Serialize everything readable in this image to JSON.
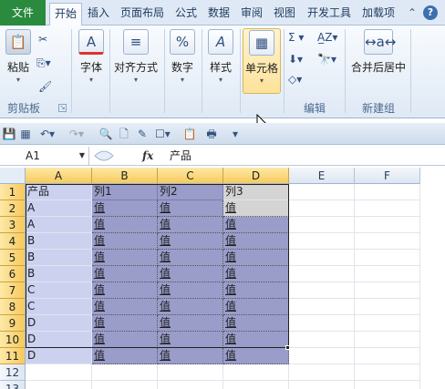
{
  "tabs": [
    {
      "label": "文件"
    },
    {
      "label": "开始"
    },
    {
      "label": "插入"
    },
    {
      "label": "页面布局"
    },
    {
      "label": "公式"
    },
    {
      "label": "数据"
    },
    {
      "label": "审阅"
    },
    {
      "label": "视图"
    },
    {
      "label": "开发工具"
    },
    {
      "label": "加载项"
    }
  ],
  "window_controls": {
    "help": "?"
  },
  "ribbon": {
    "clipboard": {
      "paste": "粘贴",
      "group": "剪贴板"
    },
    "font": {
      "label": "字体"
    },
    "alignment": {
      "label": "对齐方式"
    },
    "number": {
      "label": "数字"
    },
    "styles": {
      "label": "样式"
    },
    "cells": {
      "label": "单元格"
    },
    "editing": {
      "group": "编辑"
    },
    "new_group": {
      "merge_center": "合并后居中",
      "group": "新建组"
    }
  },
  "name_box": {
    "value": "A1"
  },
  "formula_bar": {
    "fx": "fx",
    "content": "产品"
  },
  "columns": [
    "A",
    "B",
    "C",
    "D",
    "E",
    "F"
  ],
  "rows": [
    {
      "num": "1",
      "cells": [
        "产品",
        "列1",
        "列2",
        "列3"
      ]
    },
    {
      "num": "2",
      "cells": [
        "A",
        "值",
        "值",
        "值"
      ]
    },
    {
      "num": "3",
      "cells": [
        "A",
        "值",
        "值",
        "值"
      ]
    },
    {
      "num": "4",
      "cells": [
        "B",
        "值",
        "值",
        "值"
      ]
    },
    {
      "num": "5",
      "cells": [
        "B",
        "值",
        "值",
        "值"
      ]
    },
    {
      "num": "6",
      "cells": [
        "B",
        "值",
        "值",
        "值"
      ]
    },
    {
      "num": "7",
      "cells": [
        "C",
        "值",
        "值",
        "值"
      ]
    },
    {
      "num": "8",
      "cells": [
        "C",
        "值",
        "值",
        "值"
      ]
    },
    {
      "num": "9",
      "cells": [
        "D",
        "值",
        "值",
        "值"
      ]
    },
    {
      "num": "10",
      "cells": [
        "D",
        "值",
        "值",
        "值"
      ]
    },
    {
      "num": "11",
      "cells": [
        "D",
        "值",
        "值",
        "值"
      ]
    },
    {
      "num": "12",
      "cells": [
        "",
        "",
        "",
        ""
      ]
    },
    {
      "num": "13",
      "cells": [
        "",
        "",
        "",
        ""
      ]
    }
  ],
  "colors": {
    "file_tab": "#2a8a3e",
    "table_fill": "#9a9dca",
    "col_a_fill": "#ccd1f0",
    "header_highlight": "#f7c95c"
  }
}
